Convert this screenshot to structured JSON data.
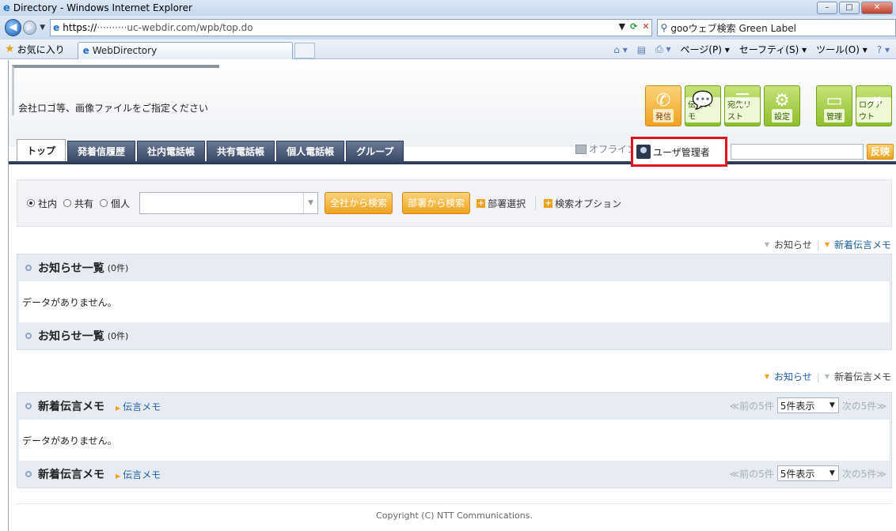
{
  "browser": {
    "window_title": "Directory - Windows Internet Explorer",
    "url_prefix": "https://",
    "url_rest": "··········uc-webdir.com/wpb/top.do",
    "search_placeholder": "gooウェブ検索 Green Label",
    "favorites_label": "お気に入り",
    "tab_title": "WebDirectory",
    "commands": [
      "ページ(P) ▾",
      "セーフティ(S) ▾",
      "ツール(O) ▾"
    ]
  },
  "header": {
    "logo_text": "会社ロゴ等、画像ファイルをご指定ください",
    "tool_buttons": [
      {
        "label": "発信",
        "icon": "phone-icon",
        "color": "orange"
      },
      {
        "label": "伝言メモ",
        "icon": "speech-bubble-icon",
        "color": "green"
      },
      {
        "label": "宛先リスト",
        "icon": "list-icon",
        "color": "green"
      },
      {
        "label": "設定",
        "icon": "gear-icon",
        "color": "green"
      },
      {
        "label": "管理",
        "icon": "monitor-icon",
        "color": "green"
      },
      {
        "label": "ログアウト",
        "icon": "logout-icon",
        "color": "green"
      }
    ],
    "nav_tabs": [
      "トップ",
      "発着信履歴",
      "社内電話帳",
      "共有電話帳",
      "個人電話帳",
      "グループ"
    ],
    "status_offline": "オフライン",
    "user_name": "ユーザ管理者",
    "reflect_button": "反映"
  },
  "search": {
    "radios": [
      {
        "label": "社内",
        "checked": true
      },
      {
        "label": "共有",
        "checked": false
      },
      {
        "label": "個人",
        "checked": false
      }
    ],
    "btn_all": "全社から検索",
    "btn_dept": "部署から検索",
    "dept_select": "部署選択",
    "options": "検索オプション"
  },
  "links_top": {
    "notice": "お知らせ",
    "new_memo": "新着伝言メモ"
  },
  "notice_section": {
    "title": "お知らせ一覧",
    "count": "(0件)",
    "empty": "データがありません。"
  },
  "links_mid": {
    "notice": "お知らせ",
    "new_memo": "新着伝言メモ"
  },
  "memo_section": {
    "title": "新着伝言メモ",
    "sublink": "伝言メモ",
    "prev": "≪前の5件",
    "select": "5件表示",
    "next": "次の5件≫",
    "empty": "データがありません。"
  },
  "footer": "Copyright (C) NTT Communications."
}
